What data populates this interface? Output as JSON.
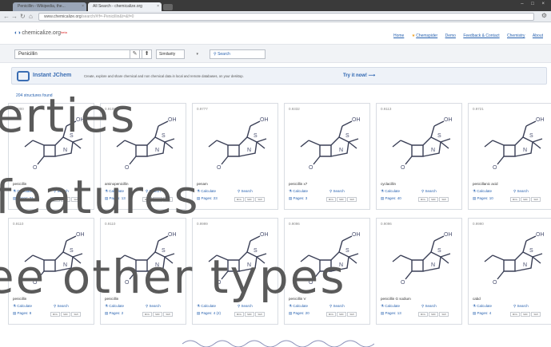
{
  "browser": {
    "tabs": [
      {
        "label": "Penicillin - Wikipedia, the..."
      },
      {
        "label": "All Search - chemicalize.org"
      }
    ],
    "window_controls": "– □ ×",
    "address": {
      "host": "www.chemicalize.org",
      "path": "/search/#!f=-Penicillin&t=&f=0"
    }
  },
  "site": {
    "logo": {
      "main": "chemicalize.org",
      "badge": "beta"
    },
    "top_links": [
      "Home",
      "Chemspider",
      "Demo",
      "Feedback & Contact",
      "Chemistry",
      "About"
    ]
  },
  "search": {
    "value": "Penicillin",
    "draw_icon": "✎",
    "upload_icon": "⬆",
    "mode": "Similarity",
    "threshold": "▾",
    "button": "Search"
  },
  "jchem": {
    "title": "Instant JChem",
    "description": "Create, explore and share chemical and non chemical data in local and remote databases, on your desktop.",
    "cta": "Try it now!"
  },
  "results_label": "204 structures found",
  "cards": [
    {
      "similarity": "0.9000",
      "name": "penicillin",
      "pages": "Pages: 21"
    },
    {
      "similarity": "0.9100",
      "name": "aminopenicillin",
      "pages": "Pages: 13"
    },
    {
      "similarity": "0.9777",
      "name": "penam",
      "pages": "Pages: 23"
    },
    {
      "similarity": "0.9332",
      "name": "penicillin x7",
      "pages": "Pages: 3"
    },
    {
      "similarity": "0.9113",
      "name": "cyclacillin",
      "pages": "Pages: 40"
    },
    {
      "similarity": "0.9721",
      "name": "penicillanic acid",
      "pages": "Pages: 10"
    },
    {
      "similarity": "0.9110",
      "name": "penicillin",
      "pages": "Pages: 8"
    },
    {
      "similarity": "0.9110",
      "name": "penicillin",
      "pages": "Pages: 2"
    },
    {
      "similarity": "0.9999",
      "name": "",
      "pages": "Pages: 4 (2)"
    },
    {
      "similarity": "0.9096",
      "name": "penicillin V",
      "pages": "Pages: 20"
    },
    {
      "similarity": "0.9096",
      "name": "penicillin G sodium",
      "pages": "Pages: 13"
    },
    {
      "similarity": "0.9990",
      "name": "cabd",
      "pages": "Pages: 4"
    }
  ],
  "card_actions": {
    "calculate": "Calculate",
    "search": "Search",
    "formats": [
      "MOL",
      "SDF",
      "SMI"
    ]
  },
  "overlay_lines": [
    "erties",
    "features",
    "ee other types"
  ]
}
